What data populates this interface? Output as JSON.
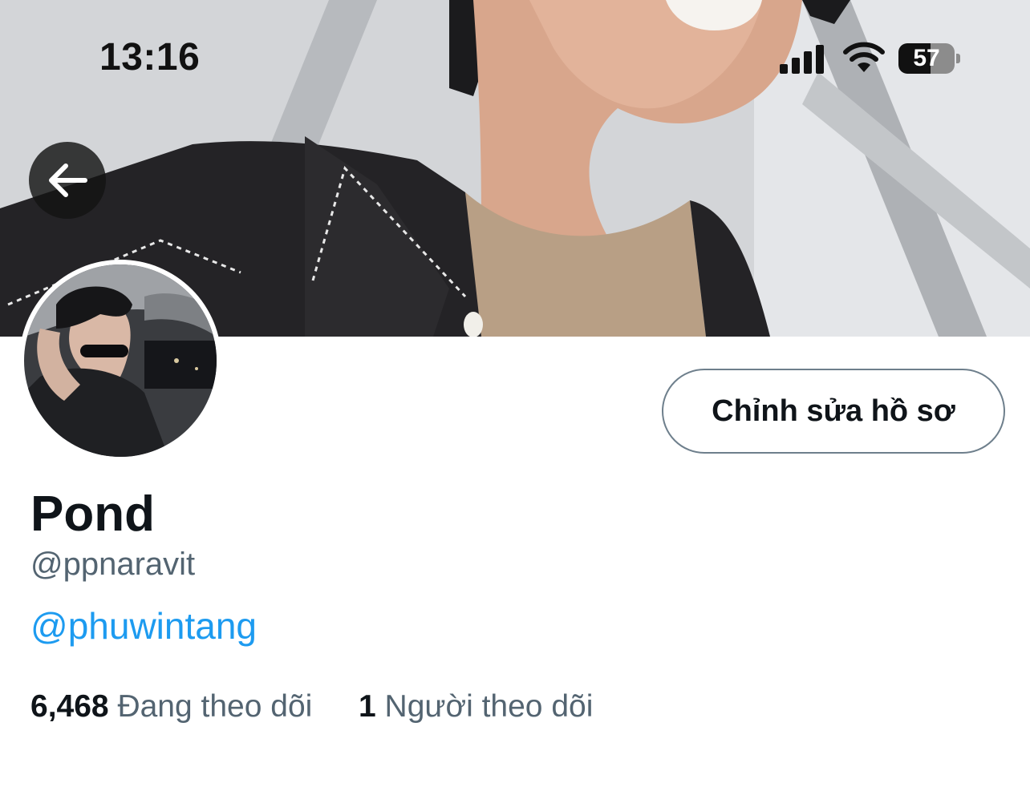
{
  "status_bar": {
    "time": "13:16",
    "battery_level": "57",
    "icons": [
      "signal-icon",
      "wifi-icon",
      "battery-icon"
    ]
  },
  "header": {
    "back_icon": "arrow-left-icon"
  },
  "profile": {
    "display_name": "Pond",
    "handle": "@ppnaravit",
    "bio_link": "@phuwintang",
    "edit_button_label": "Chỉnh sửa hồ sơ",
    "following_count": "6,468",
    "following_label": "Đang theo dõi",
    "followers_count": "1",
    "followers_label": "Người theo dõi"
  },
  "colors": {
    "link": "#1d9bf0",
    "secondary_text": "#536471",
    "primary_text": "#0f1419"
  }
}
